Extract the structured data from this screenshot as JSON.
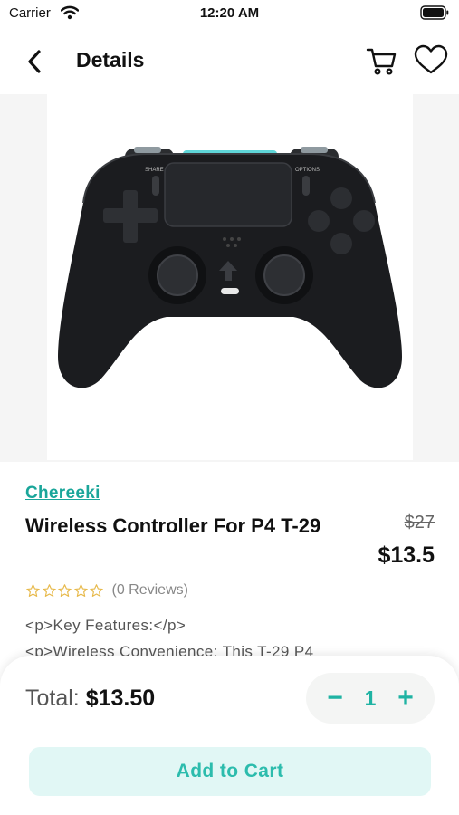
{
  "status_bar": {
    "carrier": "Carrier",
    "time": "12:20 AM"
  },
  "nav": {
    "title": "Details",
    "icons": [
      "back-chevron-icon",
      "cart-icon",
      "heart-icon"
    ]
  },
  "product": {
    "image": "black-wireless-game-controller",
    "brand": "Chereeki",
    "title": "Wireless Controller For P4 T-29",
    "old_price": "$27",
    "price": "$13.5",
    "rating": 0,
    "reviews": "(0 Reviews)",
    "description": [
      "<p>Key Features:</p>",
      "<p>Wireless Convenience: This T-29 P4"
    ]
  },
  "footer": {
    "total_label": "Total:",
    "total_value": "$13.50",
    "qty_minus": "−",
    "qty_value": "1",
    "qty_plus": "+",
    "add_to_cart": "Add to Cart"
  },
  "colors": {
    "accent": "#1fb3a3",
    "button_bg": "#e1f7f5",
    "star": "#e7b94a"
  }
}
